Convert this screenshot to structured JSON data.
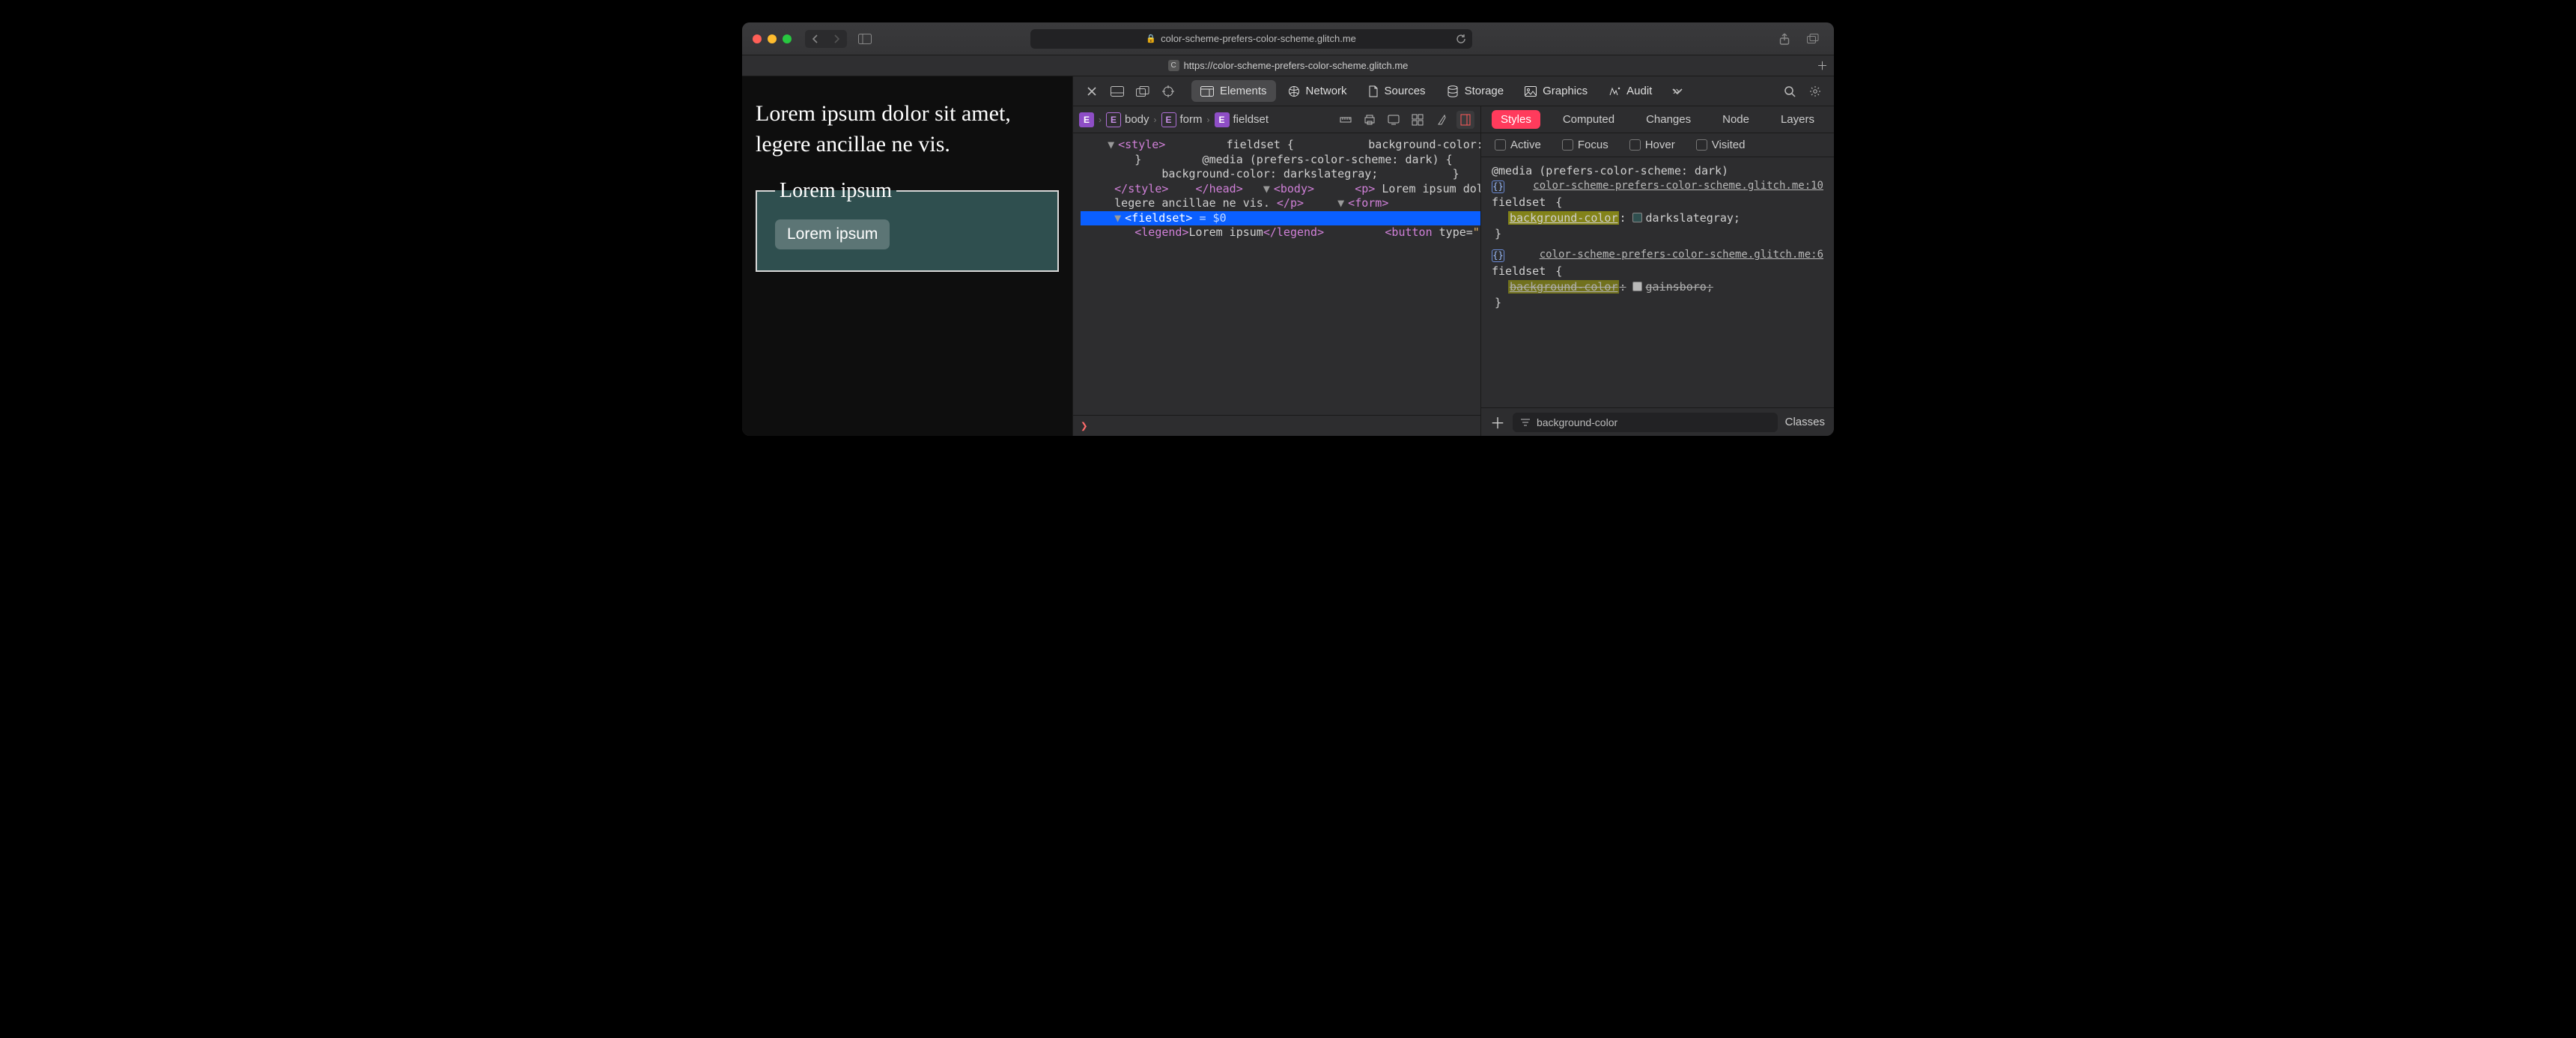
{
  "toolbar": {
    "url_host": "color-scheme-prefers-color-scheme.glitch.me",
    "tab_url": "https://color-scheme-prefers-color-scheme.glitch.me",
    "tab_favicon_letter": "C"
  },
  "devtools": {
    "tabs": [
      "Elements",
      "Network",
      "Sources",
      "Storage",
      "Graphics",
      "Audit"
    ],
    "active_tab": "Elements",
    "breadcrumb": [
      "body",
      "form",
      "fieldset"
    ],
    "console_prompt": "❯",
    "styles": {
      "tabs": [
        "Styles",
        "Computed",
        "Changes",
        "Node",
        "Layers"
      ],
      "active": "Styles",
      "pseudo": [
        "Active",
        "Focus",
        "Hover",
        "Visited"
      ],
      "rules": [
        {
          "media": "@media (prefers-color-scheme: dark)",
          "selector": "fieldset",
          "source": "color-scheme-prefers-color-scheme.glitch.me:10",
          "declarations": [
            {
              "prop": "background-color",
              "value": "darkslategray",
              "swatch": "#2f4f4f",
              "overridden": false
            }
          ]
        },
        {
          "media": "",
          "selector": "fieldset",
          "source": "color-scheme-prefers-color-scheme.glitch.me:6",
          "declarations": [
            {
              "prop": "background-color",
              "value": "gainsboro",
              "swatch": "#dcdcdc",
              "overridden": true
            }
          ]
        }
      ],
      "filter_text": "background-color",
      "footer_classes_label": "Classes"
    }
  },
  "page": {
    "paragraph": "Lorem ipsum dolor sit amet, legere ancillae ne vis.",
    "legend": "Lorem ipsum",
    "button": "Lorem ipsum"
  },
  "dom_source": {
    "style_css": "fieldset {\n  background-color: gainsboro;\n}\n@media (prefers-color-scheme: dark) {\n  fieldset {\n    background-color: darkslategray;\n  }\n}",
    "p_text": "Lorem ipsum dolor sit amet, legere ancillae ne vis.",
    "legend_text": "Lorem ipsum",
    "button_text_fragment": "Lorem",
    "selected_suffix": " = $0"
  }
}
